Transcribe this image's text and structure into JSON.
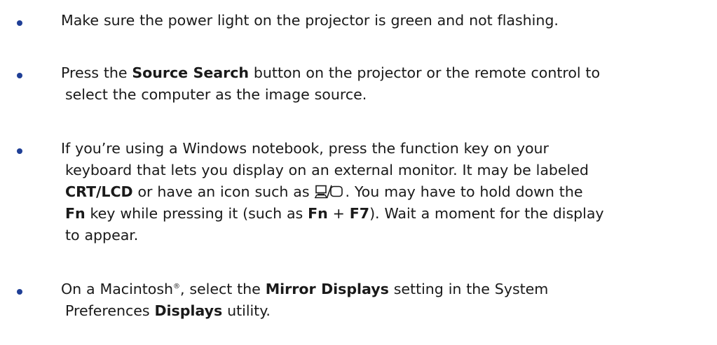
{
  "accent_color": "#1f3f96",
  "bullets": [
    {
      "line1": "Make sure the power light on the projector is green and not flashing."
    },
    {
      "pre": "Press the ",
      "bold": "Source Search",
      "post": " button on the projector or the remote control to",
      "line2": "select the computer as the image source."
    },
    {
      "line1": "If you’re using a Windows notebook, press the function key on your",
      "line2": "keyboard that lets you display on an external monitor. It may be labeled",
      "l3_bold1": "CRT/LCD",
      "l3_text1": " or have an icon such as ",
      "l3_icon": "laptop-external-monitor-icon",
      "l3_text2": ". You may have to hold down the",
      "l4_bold1": "Fn",
      "l4_text1": " key while pressing it (such as ",
      "l4_bold2": "Fn",
      "l4_plus": " + ",
      "l4_bold3": "F7",
      "l4_text2": "). Wait a moment for the display",
      "line5": "to appear."
    },
    {
      "pre": "On a Macintosh",
      "reg": "®",
      "mid": ", select the ",
      "bold": "Mirror Displays",
      "post": " setting in the System",
      "l2_pre": "Preferences ",
      "l2_bold": "Displays",
      "l2_post": " utility."
    }
  ]
}
